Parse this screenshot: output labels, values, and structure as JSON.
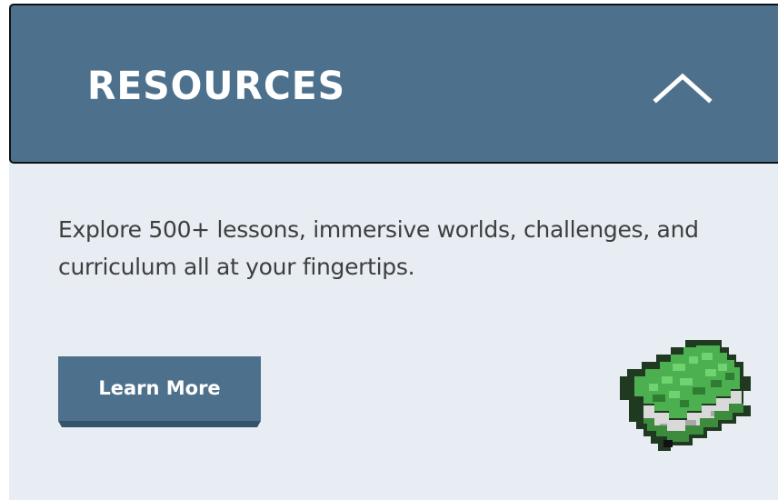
{
  "header": {
    "title": "RESOURCES",
    "toggle_icon": "chevron-up-icon"
  },
  "content": {
    "description": "Explore 500+ lessons, immersive worlds, challenges, and curriculum all at your fingertips.",
    "cta_label": "Learn More",
    "illustration_icon": "pixel-book-icon"
  },
  "colors": {
    "accent": "#4d718d",
    "panel_background": "#e7edf3",
    "text": "#3e3e3e",
    "book_green": "#4caf50"
  }
}
